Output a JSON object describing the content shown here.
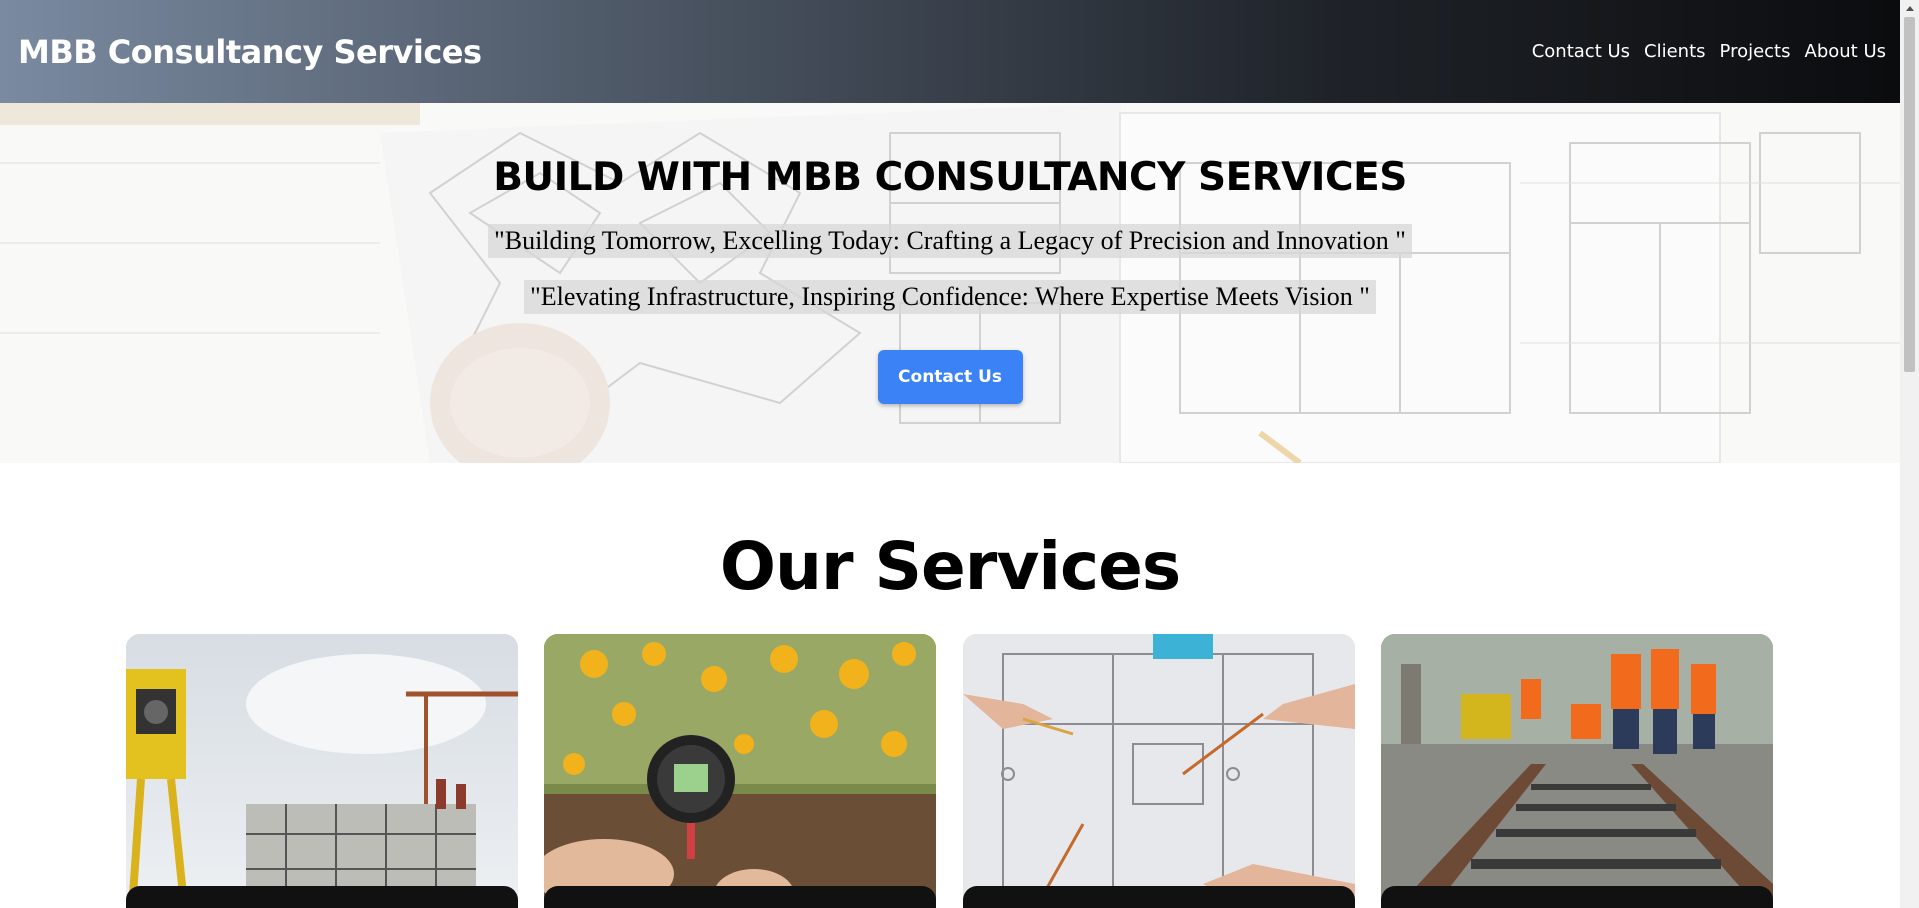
{
  "navbar": {
    "brand": "MBB Consultancy Services",
    "links": [
      "Contact Us",
      "Clients",
      "Projects",
      "About Us"
    ]
  },
  "hero": {
    "title": "BUILD WITH MBB CONSULTANCY SERVICES",
    "tagline_1": "\"Building Tomorrow, Excelling Today: Crafting a Legacy of Precision and Innovation \"",
    "tagline_2": "\"Elevating Infrastructure, Inspiring Confidence: Where Expertise Meets Vision \"",
    "cta_label": "Contact Us",
    "cta_color": "#3b82f6"
  },
  "services": {
    "title": "Our Services",
    "cards": [
      {
        "image": "construction-site-with-surveying-instrument"
      },
      {
        "image": "soil-tester-in-flower-bed"
      },
      {
        "image": "hands-pointing-at-architectural-blueprints"
      },
      {
        "image": "railway-track-workers"
      }
    ]
  },
  "colors": {
    "navbar_gradient_start": "#7a8aa0",
    "navbar_gradient_end": "#0b0c0e"
  }
}
